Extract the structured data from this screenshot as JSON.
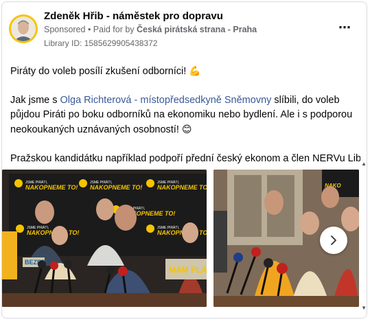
{
  "post": {
    "page_name": "Zdeněk Hřib - náměstek pro dopravu",
    "sponsored_label": "Sponsored",
    "separator": " • ",
    "paid_for_prefix": "Paid for by ",
    "paid_for_by": "Česká pirátská strana - Praha",
    "library_id": "Library ID: 1585629905438372",
    "more_icon": "⋯"
  },
  "body": {
    "line1_text": "Piráty do voleb posílí zkušení odborníci! ",
    "line1_emoji": "💪",
    "para2_before": "Jak jsme s ",
    "para2_mention": "Olga Richterová - místopředsedkyně Sněmovny",
    "para2_after": " slíbili, do voleb půjdou Piráti po boku odborníků na ekonomiku nebo bydlení. Ale i s podporou neokoukaných uznávaných osobností! ",
    "para2_emoji": "😊",
    "para3_text": "Pražskou kandidátku například podpoří přední český ekonom a člen NERVu Libor…"
  },
  "carousel": {
    "banner_small": "JSME PIRÁTI,",
    "banner_large": "NAKOPNEME TO!",
    "sign_text": "MÁM PLÁN",
    "side_sign": "BEZPE",
    "next_icon": "chevron-right-icon"
  },
  "colors": {
    "mention": "#385898",
    "banner_bg": "#1b1b1b",
    "banner_accent": "#f5c400",
    "muted": "#65676b"
  }
}
